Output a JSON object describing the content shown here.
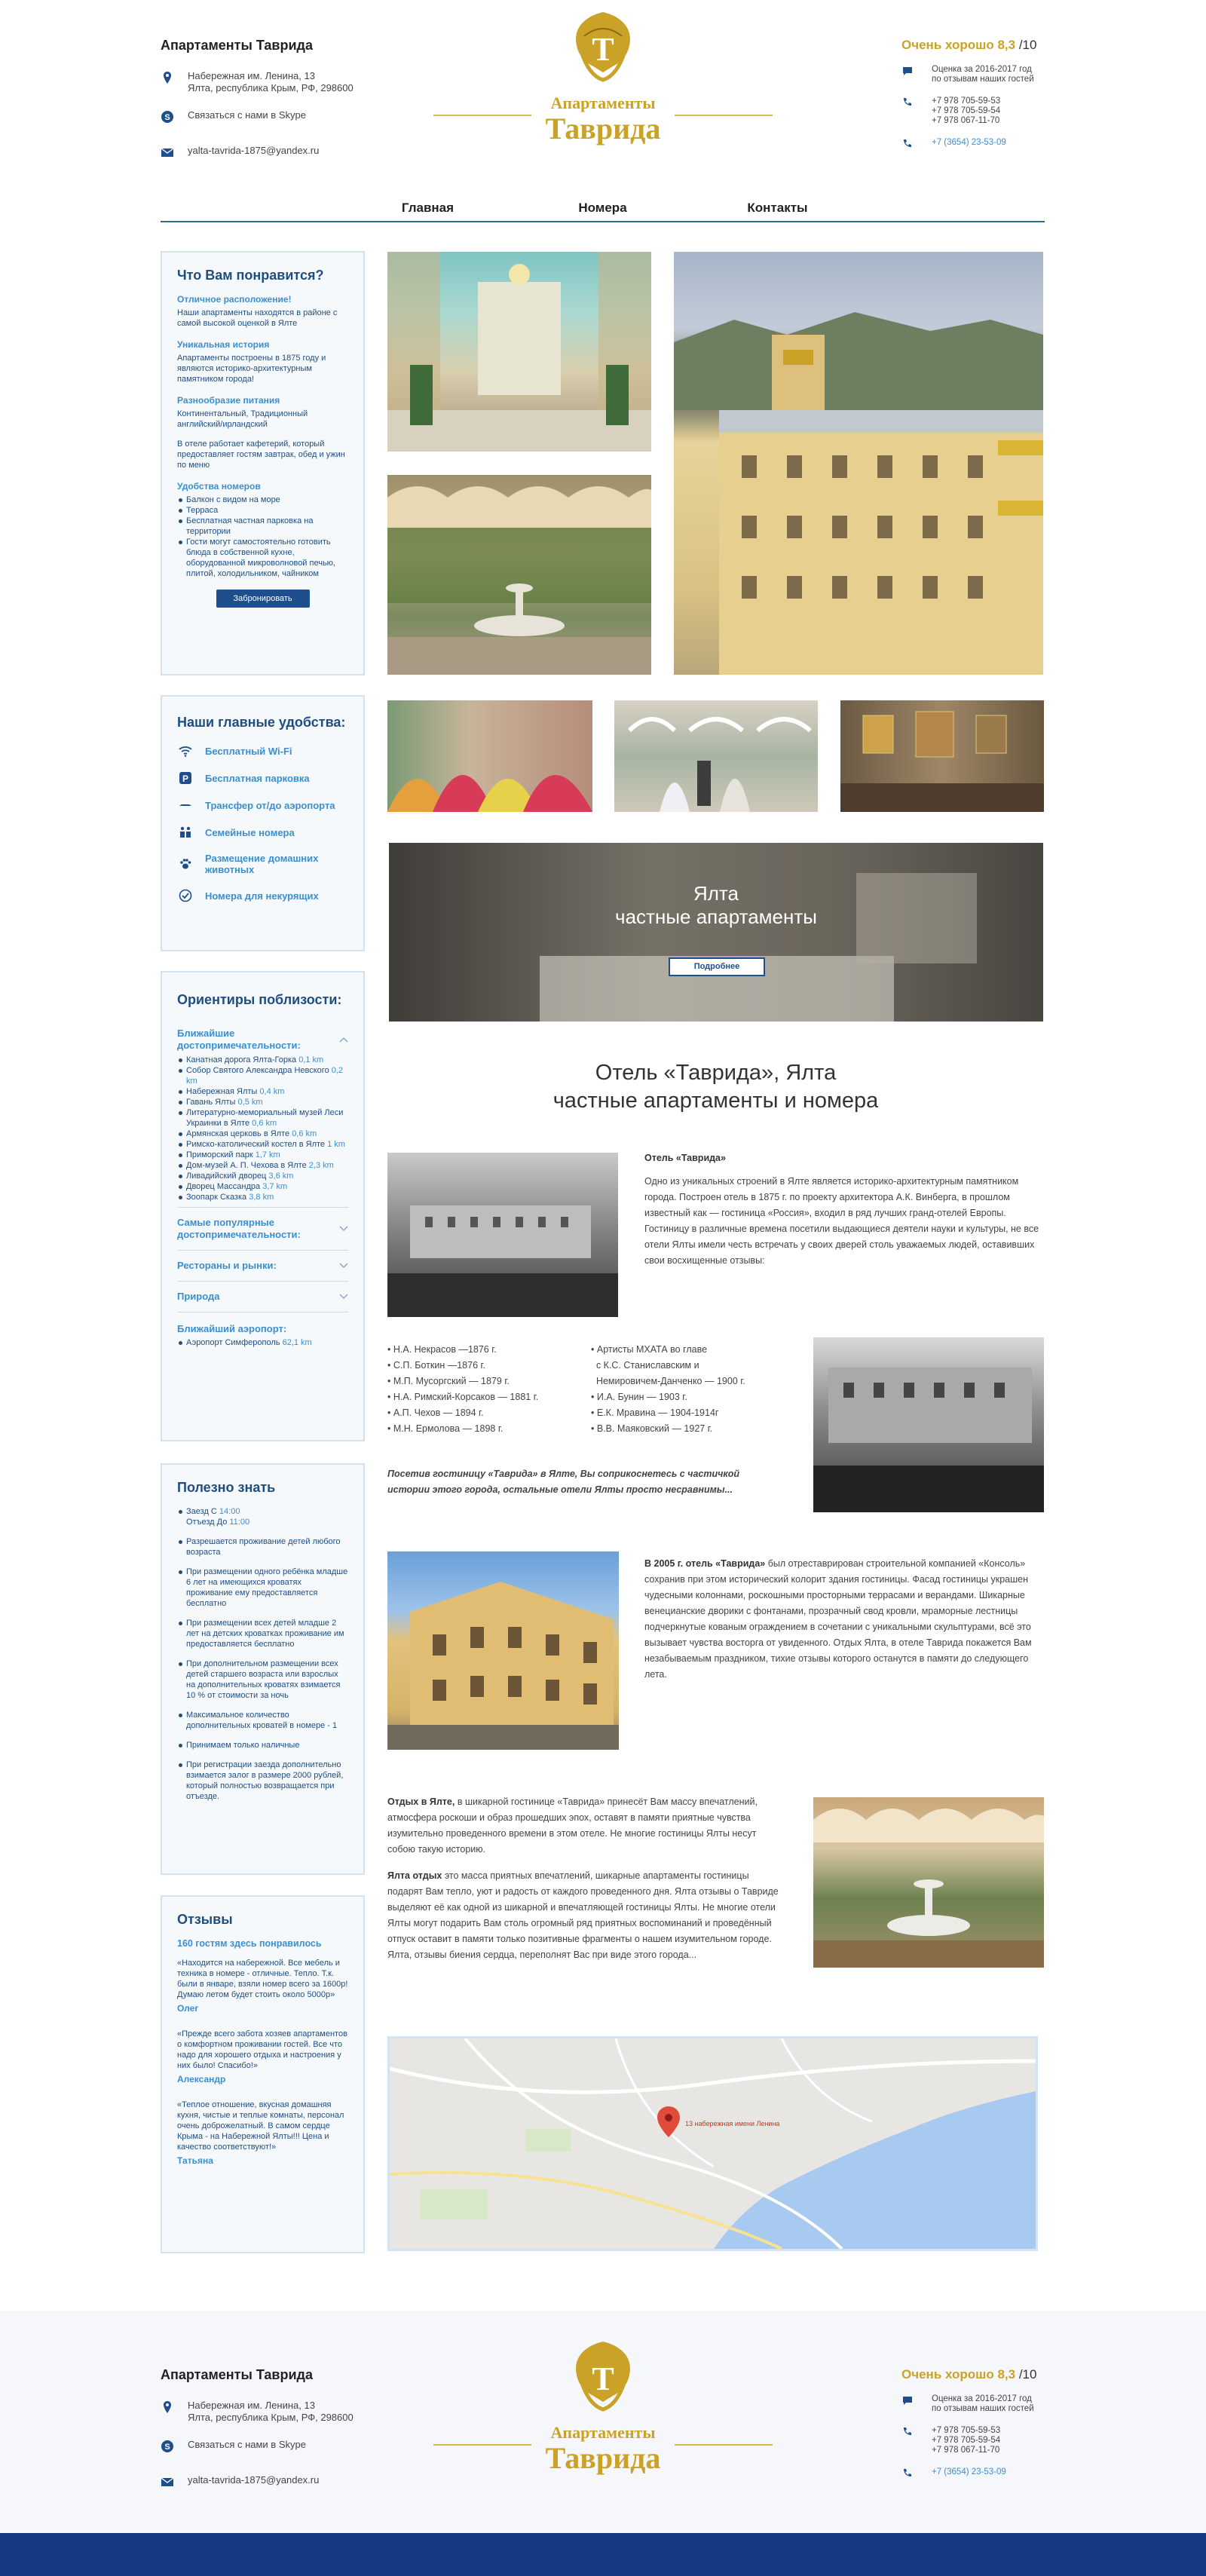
{
  "header": {
    "brand": "Апартаменты Таврида",
    "address_l1": "Набережная им. Ленина, 13",
    "address_l2": "Ялта, республика Крым, РФ, 298600",
    "skype": "Связаться с нами в Skype",
    "email": "yalta-tavrida-1875@yandex.ru",
    "logo_line1": "Апартаменты",
    "logo_line2": "Таврида",
    "logo_letter": "Т",
    "rating_label": "Очень хорошо 8,3",
    "rating_scale": "/10",
    "rating_note1": "Оценка за 2016-2017 год",
    "rating_note2": "по отзывам наших гостей",
    "phones": [
      "+7 978 705-59-53",
      "+7 978 705-59-54",
      "+7 978 067-11-70"
    ],
    "city_phone": "+7 (3654) 23-53-09"
  },
  "nav": [
    "Главная",
    "Номера",
    "Контакты"
  ],
  "likes": {
    "title": "Что Вам понравится?",
    "items": [
      {
        "h": "Отличное расположение!",
        "t": "Наши апартаменты находятся в районе с самой высокой оценкой в Ялте"
      },
      {
        "h": "Уникальная история",
        "t": "Апартаменты построены в 1875 году и являются историко-архитектурным памятником города!"
      },
      {
        "h": "Разнообразие питания",
        "t": "Континентальный, Традиционный английский/ирландский"
      }
    ],
    "cafe": "В отеле работает кафетерий, который предоставляет гостям завтрак, обед и ужин по меню",
    "rooms_h": "Удобства номеров",
    "rooms": [
      "Балкон с видом на море",
      "Терраса",
      "Бесплатная частная парковка на территории",
      "Гости могут самостоятельно готовить блюда в собственной кухне, оборудованной микроволновой печью, плитой, холодильником, чайником"
    ],
    "book": "Забронировать"
  },
  "amenities": {
    "title": "Наши главные удобства:",
    "items": [
      {
        "icon": "wifi-icon",
        "label": "Бесплатный Wi-Fi"
      },
      {
        "icon": "parking-icon",
        "label": "Бесплатная парковка"
      },
      {
        "icon": "transfer-icon",
        "label": "Трансфер от/до аэропорта"
      },
      {
        "icon": "family-icon",
        "label": "Семейные номера"
      },
      {
        "icon": "paw-icon",
        "label": "Размещение домашних животных"
      },
      {
        "icon": "check-icon",
        "label": "Номера для некурящих"
      }
    ]
  },
  "nearby": {
    "title": "Ориентиры поблизости:",
    "sights_h": "Ближайшие достопримечательности:",
    "sights": [
      {
        "n": "Канатная дорога Ялта-Горка",
        "d": "0,1 km"
      },
      {
        "n": "Собор Святого Александра Невского",
        "d": "0,2 km"
      },
      {
        "n": "Набережная Ялты",
        "d": "0,4 km"
      },
      {
        "n": "Гавань Ялты",
        "d": "0,5 km"
      },
      {
        "n": "Литературно-мемориальный музей Леси Украинки в Ялте",
        "d": "0,6 km"
      },
      {
        "n": "Армянская церковь в Ялте",
        "d": "0,6 km"
      },
      {
        "n": "Римско-католический костел в Ялте",
        "d": "1 km"
      },
      {
        "n": "Приморский парк",
        "d": "1,7 km"
      },
      {
        "n": "Дом-музей А. П. Чехова в Ялте",
        "d": "2,3 km"
      },
      {
        "n": "Ливадийский дворец",
        "d": "3,6 km"
      },
      {
        "n": "Дворец Массандра",
        "d": "3,7 km"
      },
      {
        "n": "Зоопарк Сказка",
        "d": "3,8 km"
      }
    ],
    "popular": "Самые популярные достопримечательности:",
    "food": "Рестораны и рынки:",
    "nature": "Природа",
    "airport_h": "Ближайший аэропорт:",
    "airport": "Аэропорт Симферополь",
    "airport_d": "62,1 km"
  },
  "useful": {
    "title": "Полезно знать",
    "checkin": "Заезд С",
    "checkin_t": "14:00",
    "checkout": "Отъезд До",
    "checkout_t": "11:00",
    "items": [
      "Разрешается проживание детей любого возраста",
      "При размещении одного ребёнка младше 6 лет на имеющихся кроватях проживание ему предоставляется бесплатно",
      "При размещении всех детей младше 2 лет на детских кроватках проживание им предоставляется бесплатно",
      "При дополнительном размещении всех детей старшего возраста или взрослых на дополнительных кроватях взимается 10 % от стоимости за ночь",
      "Максимальное количество дополнительных кроватей в номере - 1",
      "Принимаем только наличные",
      "При регистрации заезда дополнительно взимается залог в размере 2000 рублей, который полностью возвращается при отъезде."
    ]
  },
  "reviews": {
    "title": "Отзывы",
    "sub": "160 гостям здесь понравилось",
    "items": [
      {
        "q": "«Находится на набережной. Все мебель и техника в номере - отличные. Тепло. Т.к. были в январе, взяли номер всего за 1600р! Думаю летом будет стоить около 5000р»",
        "a": "Олег"
      },
      {
        "q": "«Прежде всего забота хозяев апартаментов о комфортном проживании гостей. Все что надо для хорошего отдыха и настроения у них было! Спасибо!»",
        "a": "Александр"
      },
      {
        "q": "«Теплое отношение, вкусная домашняя кухня, чистые и теплые комнаты, персонал очень доброжелатный. В самом сердце Крыма - на Набережной Ялты!!! Цена и качество соответствуют!»",
        "a": "Татьяна"
      }
    ]
  },
  "banner": {
    "l1": "Ялта",
    "l2": "частные апартаменты",
    "btn": "Подробнее"
  },
  "section": {
    "title1": "Отель «Таврида», Ялта",
    "title2": "частные апартаменты и номера",
    "p1_h": "Отель «Таврида»",
    "p1": "Одно из уникальных строений в Ялте является историко-архитектурным памятником города. Построен отель в 1875 г. по проекту архитектора А.К. Винберга, в прошлом известный как — гостиница «Россия», входил в ряд лучших гранд-отелей Европы. Гостиницу в различные времена посетили выдающиеся деятели науки и культуры, не все отели Ялты имели честь встречать у своих дверей столь уважаемых людей, оставивших свои восхищенные отзывы:",
    "guests1": [
      "Н.А. Некрасов —1876 г.",
      "С.П. Боткин —1876 г.",
      "М.П. Мусоргский — 1879 г.",
      "Н.А. Римский-Корсаков — 1881 г.",
      "А.П. Чехов — 1894 г.",
      "М.Н. Ермолова — 1898 г."
    ],
    "guests2": [
      "Артисты МХАТА во главе",
      "с К.С. Станиславским и",
      "Немировичем-Данченко — 1900 г.",
      "И.А. Бунин — 1903 г.",
      "Е.К. Мравина — 1904-1914г",
      "В.В. Маяковский — 1927 г."
    ],
    "italic": "Посетив гостиницу «Таврида» в Ялте, Вы соприкоснетесь с частичкой истории этого города, остальные отели Ялты просто несравнимы...",
    "p2_h": "В 2005 г. отель «Таврида»",
    "p2": "был отреставрирован строительной компанией «Консоль» сохранив при этом исторический колорит здания гостиницы. Фасад гостиницы украшен чудесными колоннами, роскошными просторными террасами и верандами. Шикарные венецианские дворики с фонтанами, прозрачный свод кровли, мраморные лестницы подчеркнутые кованым ограждением в сочетании с уникальными скульптурами, всё это вызывает чувства восторга от увиденного. Отдых Ялта, в отеле Таврида покажется Вам незабываемым праздником, тихие отзывы которого останутся в памяти до следующего лета.",
    "p3_h": "Отдых в Ялте,",
    "p3": "в шикарной гостинице «Таврида» принесёт Вам массу впечатлений, атмосфера роскоши и образ прошедших эпох, оставят в памяти приятные чувства изумительно проведенного времени в этом отеле. Не многие гостиницы Ялты несут собою такую историю.",
    "p4_h": "Ялта отдых",
    "p4": "это масса приятных впечатлений, шикарные апартаменты гостиницы подарят Вам тепло, уют и радость от каждого проведенного дня. Ялта отзывы о Тавриде выделяют её как одной из шикарной и впечатляющей гостиницы Ялты. Не многие отели Ялты могут подарить Вам столь огромный ряд приятных воспоминаний и проведённый отпуск оставит в памяти только позитивные фрагменты о нашем изумительном городе.",
    "p4b": "Ялта, отзывы биения сердца, переполнят Вас при виде этого города...",
    "map_pin": "13 набережная имени Ленина"
  },
  "colors": {
    "accent": "#3a8fd0",
    "navy": "#1e4f8c",
    "gold": "#c9a227",
    "footer_bar": "#163a82"
  }
}
